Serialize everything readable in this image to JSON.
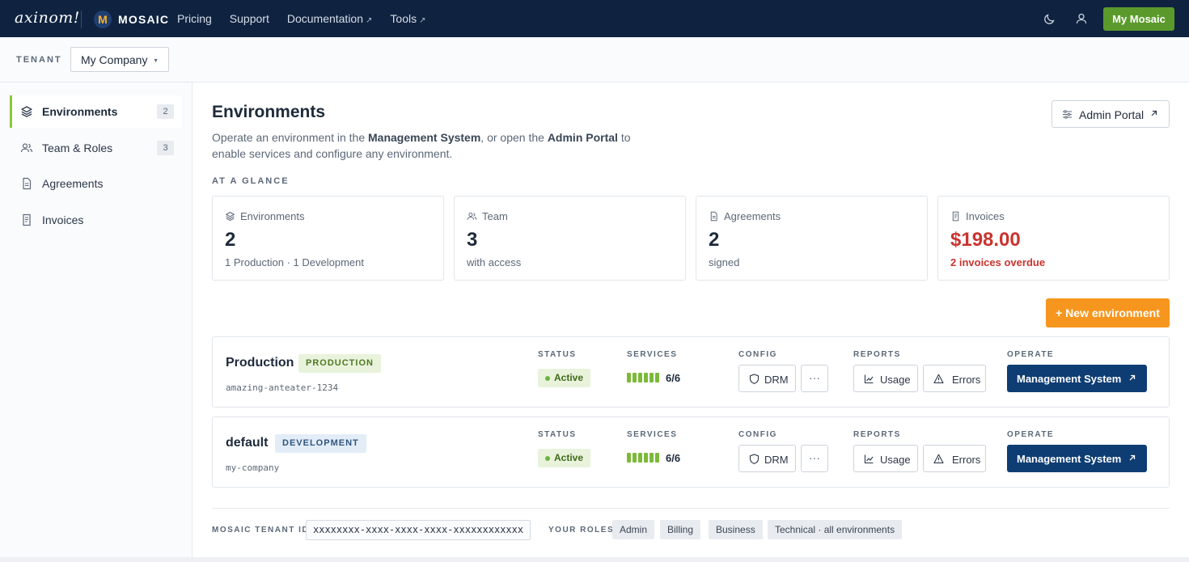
{
  "nav": {
    "brand": "axinom!",
    "product": "MOSAIC",
    "logo_letter": "M",
    "links": [
      {
        "label": "Pricing",
        "external": false
      },
      {
        "label": "Support",
        "external": false
      },
      {
        "label": "Documentation",
        "external": true
      },
      {
        "label": "Tools",
        "external": true
      }
    ],
    "external_glyph": "↗",
    "cta_label": "My Mosaic",
    "icons": [
      "moon-icon",
      "user-icon"
    ]
  },
  "tenant": {
    "label": "TENANT",
    "selected": "My Company",
    "caret": "▼"
  },
  "sidebar": {
    "items": [
      {
        "label": "Environments",
        "count": "2",
        "icon": "layers-icon",
        "active": true
      },
      {
        "label": "Team & Roles",
        "count": "3",
        "icon": "users-icon",
        "active": false
      },
      {
        "label": "Agreements",
        "count": "",
        "icon": "document-icon",
        "active": false
      },
      {
        "label": "Invoices",
        "count": "",
        "icon": "receipt-icon",
        "active": false
      }
    ]
  },
  "main": {
    "title": "Environments",
    "desc_1": "Operate an environment in the ",
    "desc_b1": "Management System",
    "desc_2": ", or open the ",
    "desc_b2": "Admin Portal",
    "desc_3": " to enable services and configure any environment.",
    "admin_portal_label": "Admin Portal",
    "glance_title": "AT A GLANCE",
    "glance": [
      {
        "label": "Environments",
        "value": "2",
        "sub": "1 Production · 1 Development",
        "icon": "layers-icon"
      },
      {
        "label": "Team",
        "value": "3",
        "sub": "with access",
        "icon": "users-icon"
      },
      {
        "label": "Agreements",
        "value": "2",
        "sub": "signed",
        "icon": "document-icon"
      },
      {
        "label": "Invoices",
        "value": "$198.00",
        "sub": "2 invoices overdue",
        "icon": "receipt-icon",
        "alert_color": "#c9342f"
      }
    ],
    "new_env_label": "+ New environment",
    "col_labels": {
      "status": "STATUS",
      "services": "SERVICES",
      "config": "CONFIG",
      "reports": "REPORTS",
      "operate": "OPERATE"
    },
    "envs": [
      {
        "name": "Production",
        "badge": "PRODUCTION",
        "slug": "amazing-anteater-1234",
        "status": "Active",
        "services": "6/6",
        "services_ratio": 1.0,
        "drm_label": "DRM",
        "more_label": "···",
        "usage_label": "Usage",
        "errors_label": "Errors",
        "operate_label": "Management System"
      },
      {
        "name": "default",
        "badge": "DEVELOPMENT",
        "slug": "my-company",
        "status": "Active",
        "services": "6/6",
        "services_ratio": 1.0,
        "drm_label": "DRM",
        "more_label": "···",
        "usage_label": "Usage",
        "errors_label": "Errors",
        "operate_label": "Management System"
      }
    ]
  },
  "footer": {
    "tenant_id_label": "MOSAIC TENANT ID",
    "tenant_id": "xxxxxxxx-xxxx-xxxx-xxxx-xxxxxxxxxxxx",
    "roles_label": "YOUR ROLES",
    "roles": [
      "Admin",
      "Billing",
      "Business",
      "Technical · all environments"
    ]
  },
  "colors": {
    "nav_bg": "#0f2340",
    "cta_green": "#5a9a2c",
    "accent_orange": "#f7961e",
    "operate_blue": "#0e3d73",
    "active_green": "#8cc63f"
  }
}
